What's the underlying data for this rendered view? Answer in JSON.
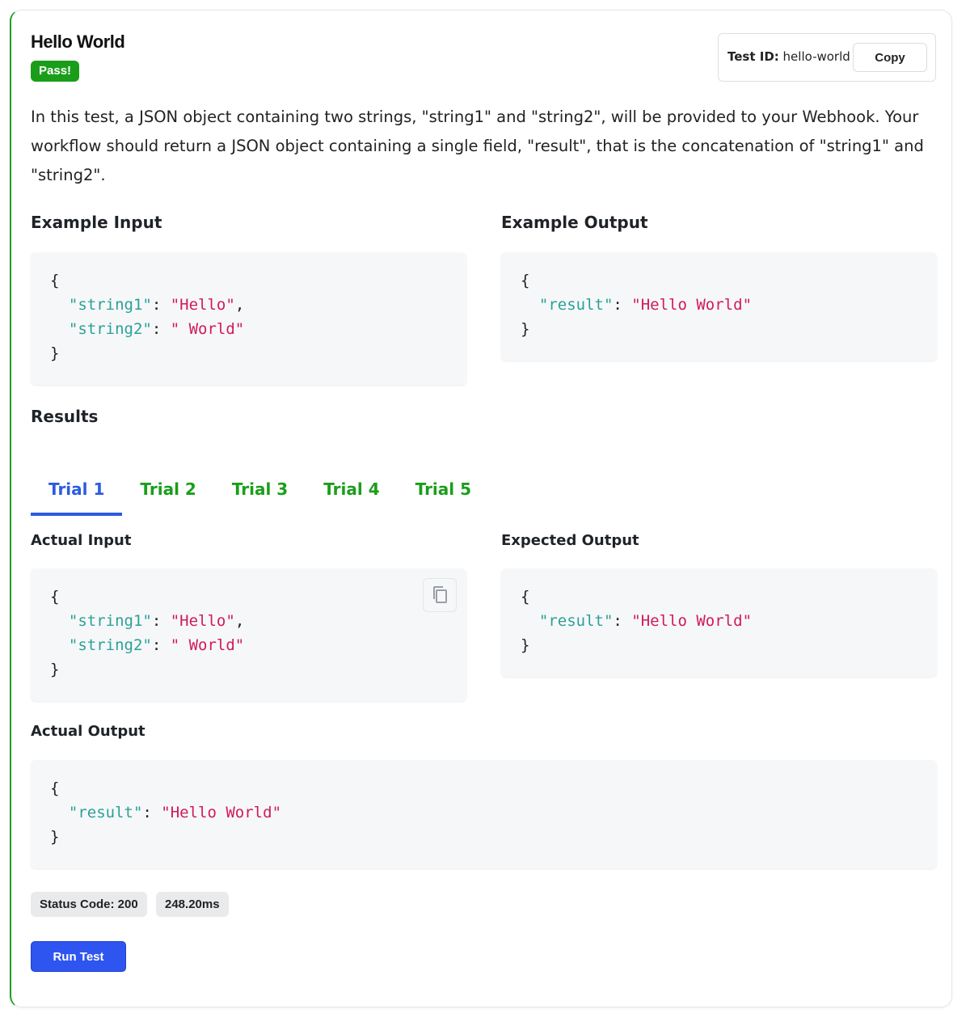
{
  "header": {
    "title": "Hello World",
    "status_badge": "Pass!",
    "test_id_label": "Test ID:",
    "test_id_value": "hello-world",
    "copy_label": "Copy"
  },
  "description": "In this test, a JSON object containing two strings, \"string1\" and \"string2\", will be provided to your Webhook. Your workflow should return a JSON object containing a single field, \"result\", that is the concatenation of \"string1\" and \"string2\".",
  "examples": {
    "input_heading": "Example Input",
    "output_heading": "Example Output",
    "input": {
      "open": "{",
      "close": "}",
      "string1_key": "\"string1\"",
      "string1_value": "\"Hello\"",
      "string2_key": "\"string2\"",
      "string2_value": "\" World\""
    },
    "output": {
      "open": "{",
      "close": "}",
      "result_key": "\"result\"",
      "result_value": "\"Hello World\""
    }
  },
  "results": {
    "heading": "Results",
    "tabs": [
      "Trial 1",
      "Trial 2",
      "Trial 3",
      "Trial 4",
      "Trial 5"
    ],
    "active_tab": "Trial 1",
    "actual_input_heading": "Actual Input",
    "expected_output_heading": "Expected Output",
    "actual_output_heading": "Actual Output",
    "actual_input": {
      "open": "{",
      "close": "}",
      "string1_key": "\"string1\"",
      "string1_value": "\"Hello\"",
      "string2_key": "\"string2\"",
      "string2_value": "\" World\""
    },
    "expected_output": {
      "open": "{",
      "close": "}",
      "result_key": "\"result\"",
      "result_value": "\"Hello World\""
    },
    "actual_output": {
      "open": "{",
      "close": "}",
      "result_key": "\"result\"",
      "result_value": "\"Hello World\""
    },
    "status_code": "Status Code: 200",
    "duration": "248.20ms"
  },
  "actions": {
    "run_test_label": "Run Test"
  },
  "colors": {
    "pass_green": "#1a9e1a",
    "active_tab_blue": "#2b5be0",
    "run_button_blue": "#2f55f0",
    "json_key": "#2aa198",
    "json_string": "#d11a5a"
  },
  "icons": {
    "copy": "copy-icon"
  }
}
